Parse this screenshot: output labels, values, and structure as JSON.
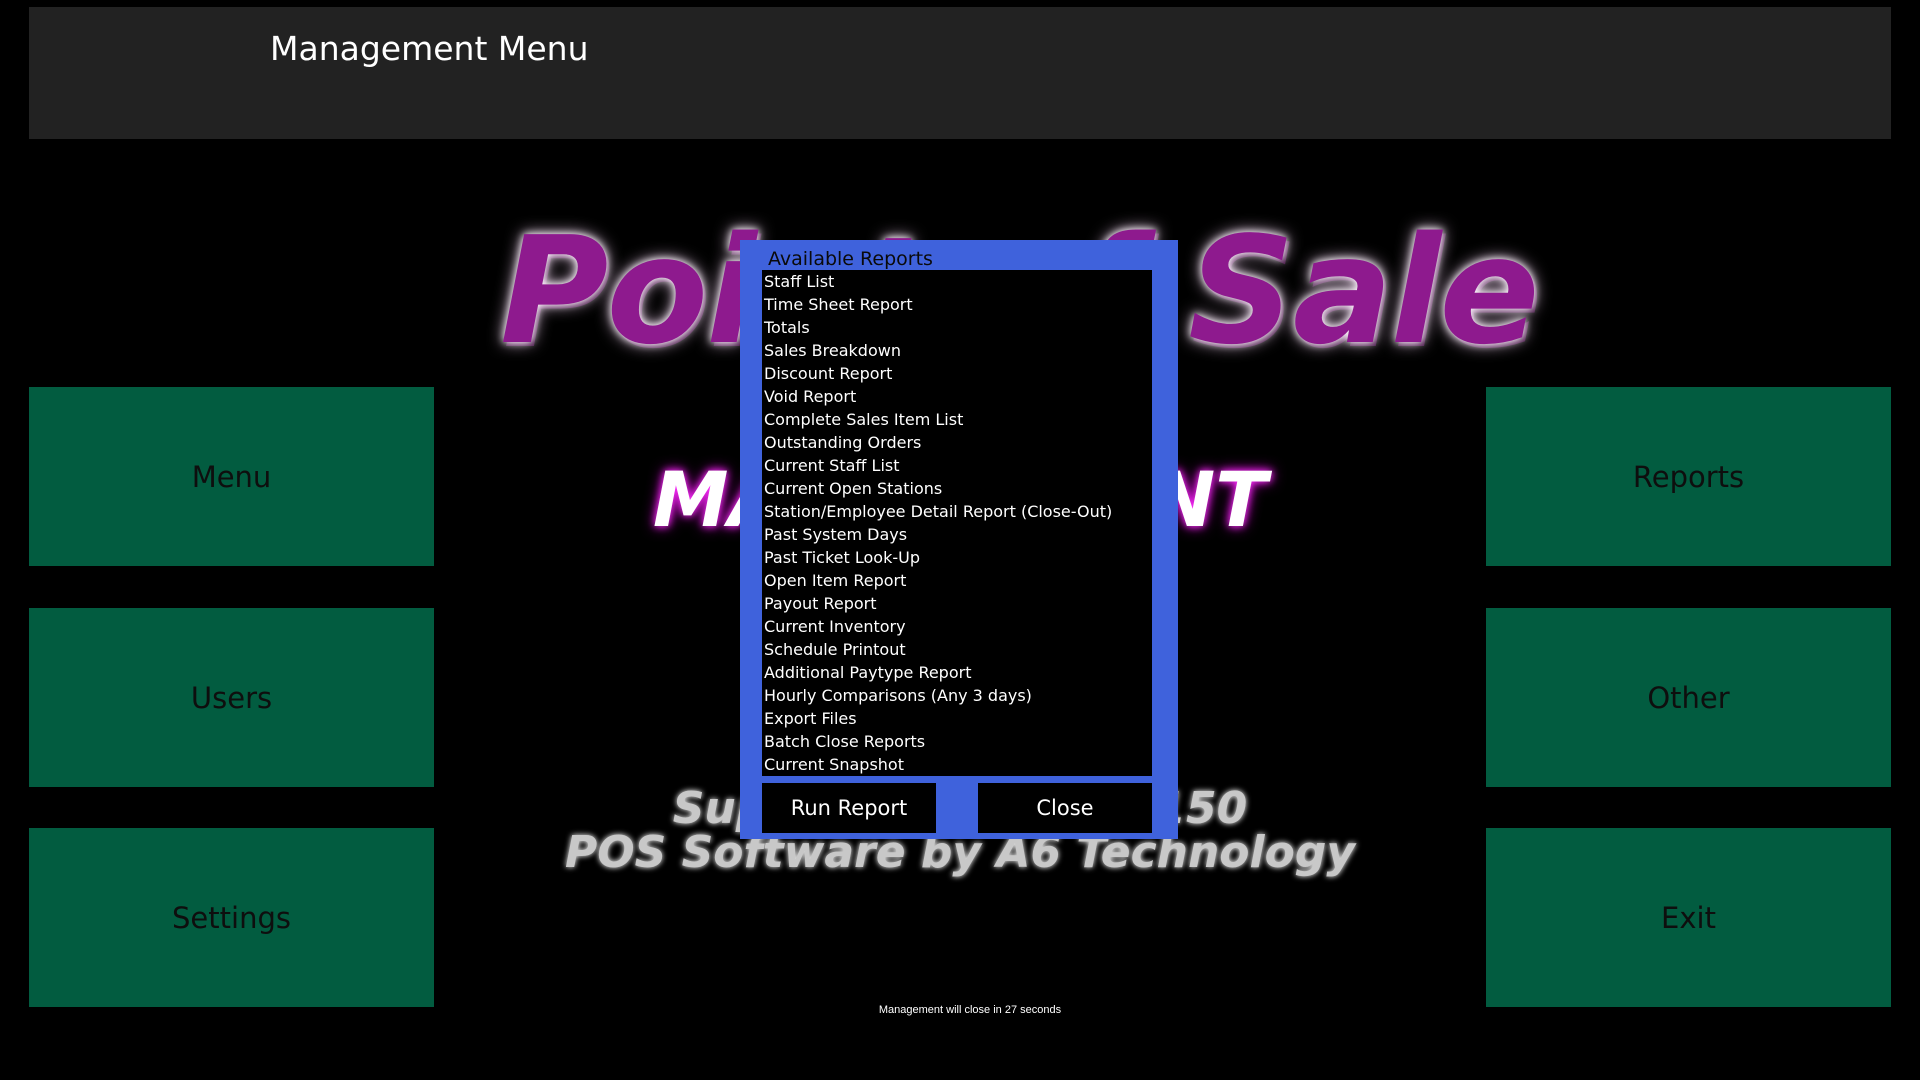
{
  "header": {
    "title": "Management Menu"
  },
  "background": {
    "logo_text": "Point of Sale",
    "subtitle_text": "MANAGEMENT",
    "support_text": "Support: 888-888-8150",
    "credit_text": "POS Software by A6 Technology",
    "logo_color": "#8e1a8e"
  },
  "tiles": {
    "menu": "Menu",
    "users": "Users",
    "settings": "Settings",
    "reports": "Reports",
    "other": "Other",
    "exit": "Exit",
    "tile_color": "#025c40"
  },
  "dialog": {
    "title": "Available Reports",
    "accent_color": "#3f62dc",
    "reports": [
      "Staff List",
      "Time Sheet Report",
      "Totals",
      "Sales Breakdown",
      "Discount Report",
      "Void Report",
      "Complete Sales Item List",
      "Outstanding Orders",
      "Current Staff List",
      "Current Open Stations",
      "Station/Employee Detail Report (Close-Out)",
      "Past System Days",
      "Past Ticket Look-Up",
      "Open Item Report",
      "Payout Report",
      "Current Inventory",
      "Schedule Printout",
      "Additional Paytype Report",
      "Hourly Comparisons (Any 3 days)",
      "Export Files",
      "Batch Close Reports",
      "Current Snapshot"
    ],
    "run_label": "Run Report",
    "close_label": "Close"
  },
  "footer": {
    "note": "Management will close in 27 seconds"
  }
}
